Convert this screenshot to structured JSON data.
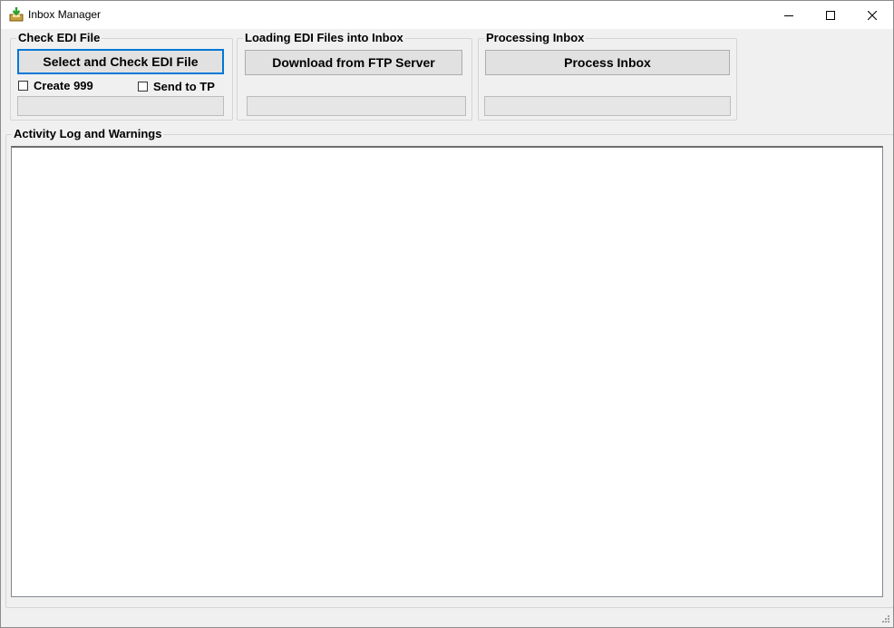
{
  "window": {
    "title": "Inbox Manager",
    "icon": "inbox-download-icon",
    "controls": {
      "minimize": "minimize-icon",
      "maximize": "maximize-icon",
      "close": "close-icon"
    }
  },
  "check_edi": {
    "legend": "Check EDI File",
    "button_label": "Select and Check EDI File",
    "checkbox_create_999": {
      "label": "Create 999",
      "checked": false
    },
    "checkbox_send_to_tp": {
      "label": "Send to TP",
      "checked": false
    }
  },
  "loading": {
    "legend": "Loading EDI Files into Inbox",
    "button_label": "Download from FTP Server"
  },
  "processing": {
    "legend": "Processing Inbox",
    "button_label": "Process Inbox"
  },
  "activity_log": {
    "legend": "Activity Log and Warnings",
    "content": ""
  },
  "colors": {
    "focus_border": "#0078d7",
    "button_face": "#e1e1e1",
    "window_bg": "#f0f0f0"
  }
}
